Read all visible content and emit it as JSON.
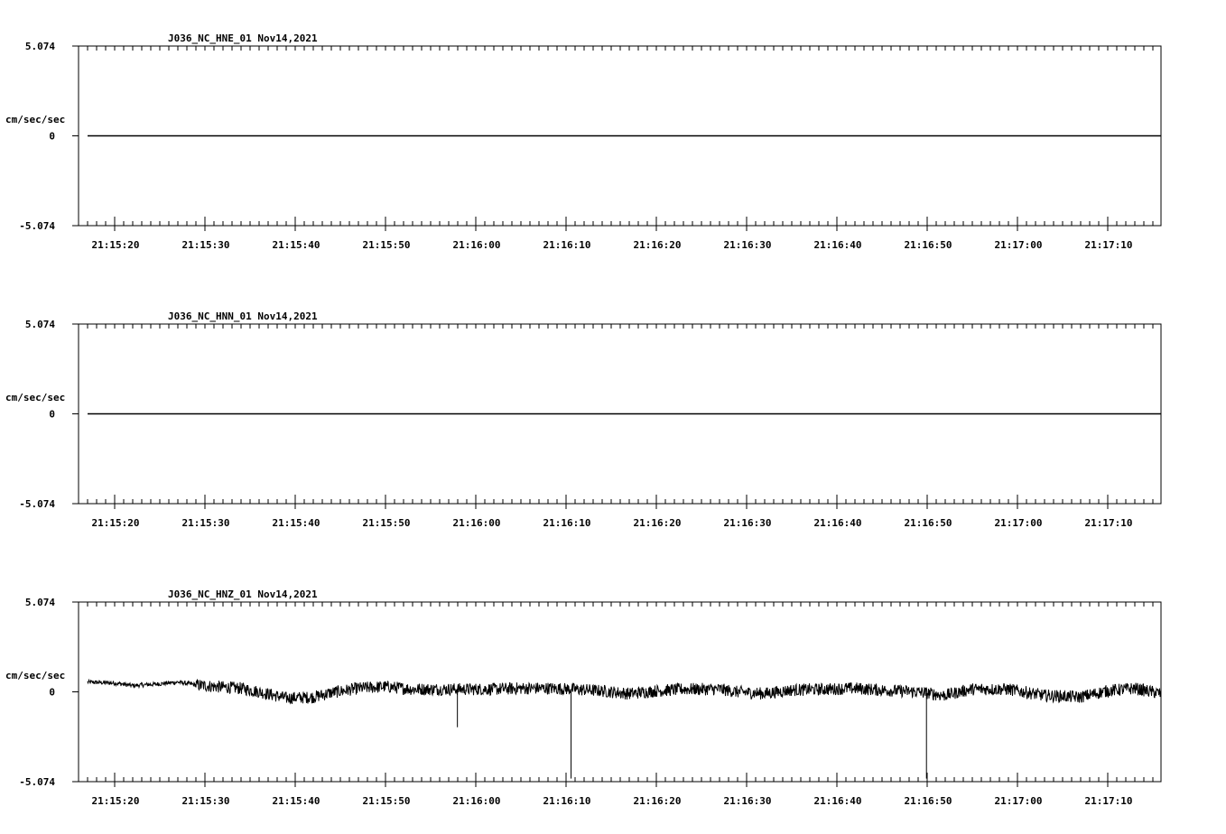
{
  "chart_data": [
    {
      "type": "line",
      "title": "J036_NC_HNE_01   Nov14,2021",
      "ylabel": "cm/sec/sec",
      "ylim": [
        -5.074,
        5.074
      ],
      "y_tick_labels": [
        "5.074",
        "0",
        "-5.074"
      ],
      "x_tick_labels": [
        "21:15:20",
        "21:15:30",
        "21:15:40",
        "21:15:50",
        "21:16:00",
        "21:16:10",
        "21:16:20",
        "21:16:30",
        "21:16:40",
        "21:16:50",
        "21:17:00",
        "21:17:10"
      ],
      "series": [
        {
          "shape": "flat",
          "values": [
            [
              0,
              0
            ],
            [
              118.9,
              0
            ]
          ]
        }
      ]
    },
    {
      "type": "line",
      "title": "J036_NC_HNN_01   Nov14,2021",
      "ylabel": "cm/sec/sec",
      "ylim": [
        -5.074,
        5.074
      ],
      "y_tick_labels": [
        "5.074",
        "0",
        "-5.074"
      ],
      "x_tick_labels": [
        "21:15:20",
        "21:15:30",
        "21:15:40",
        "21:15:50",
        "21:16:00",
        "21:16:10",
        "21:16:20",
        "21:16:30",
        "21:16:40",
        "21:16:50",
        "21:17:00",
        "21:17:10"
      ],
      "series": [
        {
          "shape": "flat",
          "values": [
            [
              0,
              0
            ],
            [
              118.9,
              0
            ]
          ]
        }
      ]
    },
    {
      "type": "line",
      "title": "J036_NC_HNZ_01   Nov14,2021",
      "ylabel": "cm/sec/sec",
      "ylim": [
        -5.074,
        5.074
      ],
      "y_tick_labels": [
        "5.074",
        "0",
        "-5.074"
      ],
      "x_tick_labels": [
        "21:15:20",
        "21:15:30",
        "21:15:40",
        "21:15:50",
        "21:16:00",
        "21:16:10",
        "21:16:20",
        "21:16:30",
        "21:16:40",
        "21:16:50",
        "21:17:00",
        "21:17:10"
      ],
      "series": [
        {
          "shape": "noisy",
          "baseline": [
            [
              0,
              0.55
            ],
            [
              3,
              0.5
            ],
            [
              5,
              0.35
            ],
            [
              8,
              0.45
            ],
            [
              10,
              0.55
            ],
            [
              12,
              0.4
            ],
            [
              14,
              0.3
            ],
            [
              17,
              0.2
            ],
            [
              19,
              0.0
            ],
            [
              22,
              -0.35
            ],
            [
              25,
              -0.3
            ],
            [
              27,
              -0.05
            ],
            [
              30,
              0.2
            ],
            [
              33,
              0.3
            ],
            [
              36,
              0.15
            ],
            [
              40,
              0.15
            ],
            [
              45,
              0.15
            ],
            [
              48,
              0.2
            ],
            [
              51,
              0.2
            ],
            [
              54,
              0.15
            ],
            [
              57,
              0.05
            ],
            [
              60,
              -0.1
            ],
            [
              63,
              0.05
            ],
            [
              66,
              0.15
            ],
            [
              70,
              0.15
            ],
            [
              72,
              0.0
            ],
            [
              75,
              -0.1
            ],
            [
              78,
              0.1
            ],
            [
              82,
              0.15
            ],
            [
              85,
              0.2
            ],
            [
              88,
              0.1
            ],
            [
              92,
              0.0
            ],
            [
              95,
              -0.2
            ],
            [
              98,
              0.15
            ],
            [
              102,
              0.15
            ],
            [
              106,
              -0.2
            ],
            [
              110,
              -0.3
            ],
            [
              113,
              0.05
            ],
            [
              116,
              0.2
            ],
            [
              119,
              -0.1
            ]
          ],
          "noise_amplitude": 0.35,
          "spikes": [
            [
              41,
              -2.0
            ],
            [
              53.6,
              -4.9
            ],
            [
              93.0,
              -4.9
            ]
          ]
        }
      ]
    }
  ]
}
